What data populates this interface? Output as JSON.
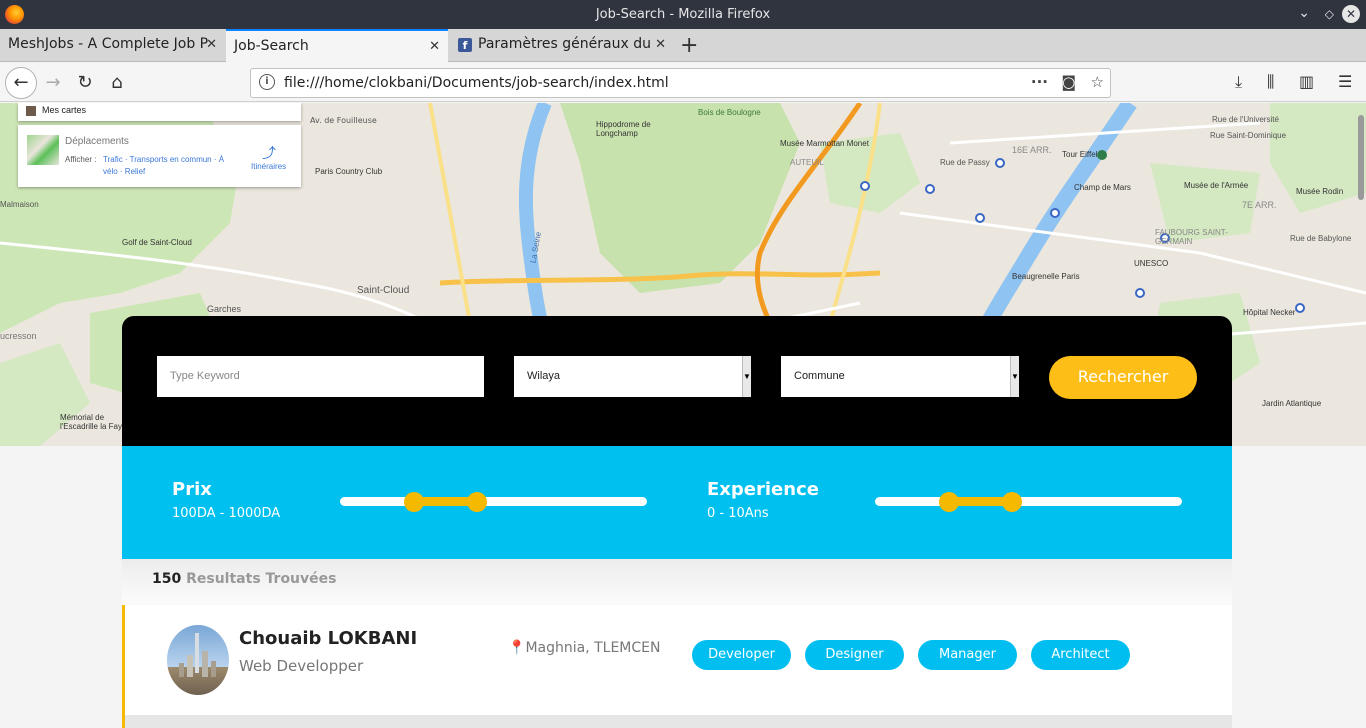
{
  "window": {
    "title": "Job-Search - Mozilla Firefox"
  },
  "tabs": [
    {
      "label": "MeshJobs - A Complete Job P"
    },
    {
      "label": "Job-Search"
    },
    {
      "label": "Paramètres généraux du"
    }
  ],
  "navbar": {
    "url": "file:///home/clokbani/Documents/job-search/index.html"
  },
  "map": {
    "card_mes_cartes": "Mes cartes",
    "card_deplacements": "Déplacements",
    "card_afficher": "Afficher :",
    "card_links_1": "Trafic · Transports en commun · À",
    "card_links_2": "vélo · Relief",
    "card_itineraires": "Itinéraires",
    "labels": {
      "fouilleuse": "Av. de Fouilleuse",
      "paris_country": "Paris Country Club",
      "golf": "Golf de Saint-Cloud",
      "saint_cloud": "Saint-Cloud",
      "garches": "Garches",
      "hippodrome": "Hippodrome de Longchamp",
      "bois": "Bois de Boulogne",
      "marmottan": "Musée Marmottan Monet",
      "auteuil": "AUTEUIL",
      "passy": "Rue de Passy",
      "arr16": "16E ARR.",
      "tour_eiffel": "Tour Eiffel",
      "champ_mars": "Champ de Mars",
      "armee": "Musée de l'Armée",
      "rodin": "Musée Rodin",
      "arr7": "7E ARR.",
      "faubourg": "FAUBOURG SAINT-GERMAIN",
      "unesco": "UNESCO",
      "beaugrenelle": "Beaugrenelle Paris",
      "necker": "Hôpital Necker",
      "jardin": "Jardin Atlantique",
      "memorial": "Mémorial de l'Escadrille la Fayette",
      "seine": "La Seine",
      "malmaison": "Malmaison",
      "ucresson": "ucresson",
      "university": "Rue de l'Université",
      "dominique": "Rue Saint-Dominique",
      "babylone": "Rue de Babylone"
    }
  },
  "search": {
    "keyword_placeholder": "Type Keyword",
    "wilaya": "Wilaya",
    "commune": "Commune",
    "button": "Rechercher"
  },
  "filters": {
    "price": {
      "label": "Prix",
      "range": "100DA - 1000DA",
      "low_fraction": 0.24,
      "high_fraction": 0.445
    },
    "experience": {
      "label": "Experience",
      "range": "0 - 10Ans",
      "low_fraction": 0.24,
      "high_fraction": 0.445
    }
  },
  "results": {
    "count": "150",
    "count_label": "Resultats Trouvées",
    "items": [
      {
        "name": "Chouaib LOKBANI",
        "job": "Web Developper",
        "location": "Maghnia, TLEMCEN",
        "tags": [
          "Developer",
          "Designer",
          "Manager",
          "Architect"
        ]
      }
    ]
  },
  "colors": {
    "accent": "#fdbe18",
    "blue": "#00c0f0",
    "dark": "#000000"
  }
}
